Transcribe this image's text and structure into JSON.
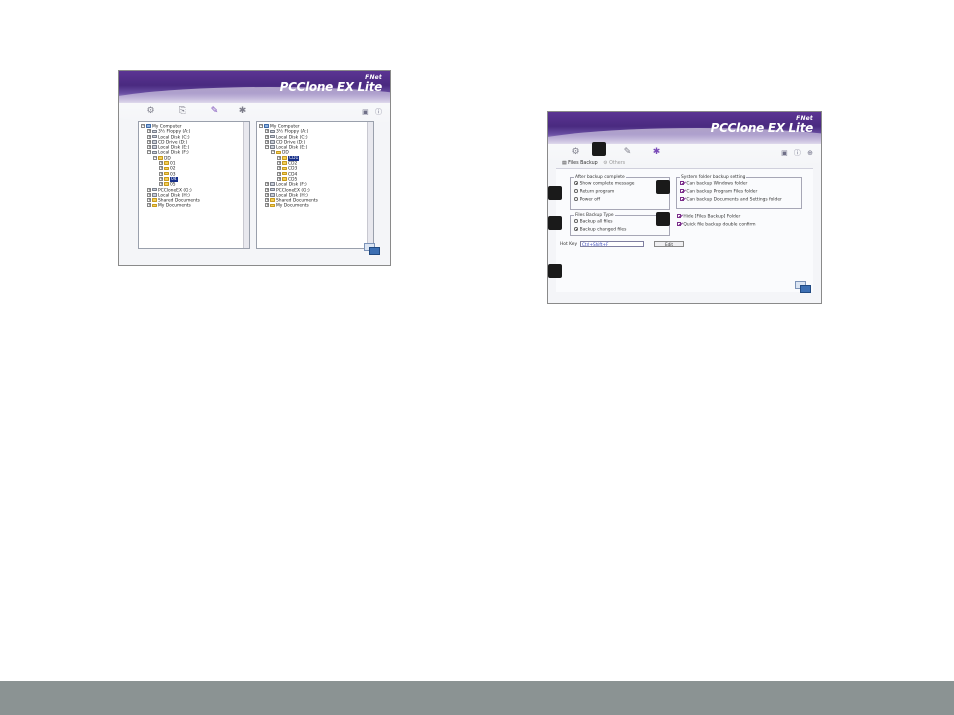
{
  "screenshot_left": {
    "brand": {
      "company": "FNet",
      "product": "PCClone EX Lite"
    },
    "toolbar": {
      "icons": [
        "backup-icon",
        "clone-icon",
        "restore-icon",
        "settings-icon"
      ],
      "right_icons": "▣ ⓘ"
    },
    "left_tree": [
      {
        "indent": 0,
        "exp": "−",
        "icon": "pc",
        "label": "My Computer"
      },
      {
        "indent": 1,
        "exp": "+",
        "icon": "drive",
        "label": "3½ Floppy (A:)"
      },
      {
        "indent": 1,
        "exp": "+",
        "icon": "drive",
        "label": "Local Disk (C:)"
      },
      {
        "indent": 1,
        "exp": "+",
        "icon": "drive",
        "label": "CD Drive (D:)"
      },
      {
        "indent": 1,
        "exp": "+",
        "icon": "drive",
        "label": "Local Disk (E:)"
      },
      {
        "indent": 1,
        "exp": "−",
        "icon": "drive",
        "label": "Local Disk (F:)"
      },
      {
        "indent": 2,
        "exp": "−",
        "icon": "folder",
        "label": "DD"
      },
      {
        "indent": 3,
        "exp": "+",
        "icon": "folder",
        "label": "01"
      },
      {
        "indent": 3,
        "exp": "+",
        "icon": "folder",
        "label": "02"
      },
      {
        "indent": 3,
        "exp": "+",
        "icon": "folder",
        "label": "03"
      },
      {
        "indent": 3,
        "exp": "+",
        "icon": "folder",
        "label": "04",
        "selected": true
      },
      {
        "indent": 3,
        "exp": "+",
        "icon": "folder",
        "label": "05"
      },
      {
        "indent": 1,
        "exp": "+",
        "icon": "drive",
        "label": "PCCloneEX (G:)"
      },
      {
        "indent": 1,
        "exp": "+",
        "icon": "drive",
        "label": "Local Disk (H:)"
      },
      {
        "indent": 1,
        "exp": "+",
        "icon": "folder",
        "label": "Shared Documents"
      },
      {
        "indent": 1,
        "exp": "+",
        "icon": "folder",
        "label": "My Documents"
      }
    ],
    "right_tree": [
      {
        "indent": 0,
        "exp": "−",
        "icon": "pc",
        "label": "My Computer"
      },
      {
        "indent": 1,
        "exp": "+",
        "icon": "drive",
        "label": "3½ Floppy (A:)"
      },
      {
        "indent": 1,
        "exp": "+",
        "icon": "drive",
        "label": "Local Disk (C:)"
      },
      {
        "indent": 1,
        "exp": "+",
        "icon": "drive",
        "label": "CD Drive (D:)"
      },
      {
        "indent": 1,
        "exp": "−",
        "icon": "drive",
        "label": "Local Disk (E:)"
      },
      {
        "indent": 2,
        "exp": "−",
        "icon": "folder",
        "label": "DD"
      },
      {
        "indent": 3,
        "exp": "+",
        "icon": "folder",
        "label": "CD1",
        "selected": true
      },
      {
        "indent": 3,
        "exp": "+",
        "icon": "folder",
        "label": "CD2"
      },
      {
        "indent": 3,
        "exp": "+",
        "icon": "folder",
        "label": "CD3"
      },
      {
        "indent": 3,
        "exp": "+",
        "icon": "folder",
        "label": "CD4"
      },
      {
        "indent": 3,
        "exp": "+",
        "icon": "folder",
        "label": "CD5"
      },
      {
        "indent": 1,
        "exp": "+",
        "icon": "drive",
        "label": "Local Disk (F:)"
      },
      {
        "indent": 1,
        "exp": "+",
        "icon": "drive",
        "label": "PCCloneEX (G:)"
      },
      {
        "indent": 1,
        "exp": "+",
        "icon": "drive",
        "label": "Local Disk (H:)"
      },
      {
        "indent": 1,
        "exp": "+",
        "icon": "folder",
        "label": "Shared Documents"
      },
      {
        "indent": 1,
        "exp": "+",
        "icon": "folder",
        "label": "My Documents"
      }
    ]
  },
  "screenshot_right": {
    "brand": {
      "company": "FNet",
      "product": "PCClone EX Lite"
    },
    "tabs": {
      "files_backup": "Files Backup",
      "others": "Others"
    },
    "right_icons": "▣ ⓘ ⊕",
    "after_backup": {
      "legend": "After backup complete",
      "options": [
        "Show complete message",
        "Return program",
        "Power off"
      ],
      "selected": 0
    },
    "backup_type": {
      "legend": "Files Backup Type",
      "options": [
        "Backup all files",
        "Backup changed files"
      ],
      "selected": 1
    },
    "system_folder": {
      "legend": "System folder backup setting",
      "options": [
        "Can backup Windows folder",
        "Can backup Program Files folder",
        "Can backup Documents and Settings folder"
      ]
    },
    "hide_folder": "Hide [Files Backup] Folder",
    "quick_confirm": "Quick file backup double confirm",
    "hotkey": {
      "label": "Hot Key",
      "value": "Ctrl+Shift+F",
      "edit": "Edit"
    }
  }
}
